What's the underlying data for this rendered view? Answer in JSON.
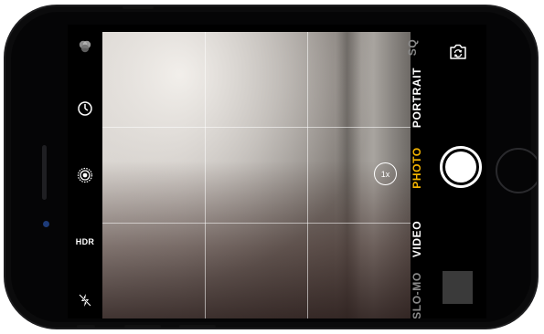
{
  "camera": {
    "left_tools": [
      {
        "icon": "filters-icon"
      },
      {
        "icon": "timer-icon"
      },
      {
        "icon": "live-photo-icon"
      },
      {
        "label": "HDR"
      },
      {
        "icon": "flash-off-icon"
      }
    ],
    "zoom_label": "1x",
    "modes": [
      "SQ",
      "PORTRAIT",
      "PHOTO",
      "VIDEO",
      "SLO-MO"
    ],
    "active_mode": "PHOTO",
    "accent_color": "#f4b400"
  }
}
